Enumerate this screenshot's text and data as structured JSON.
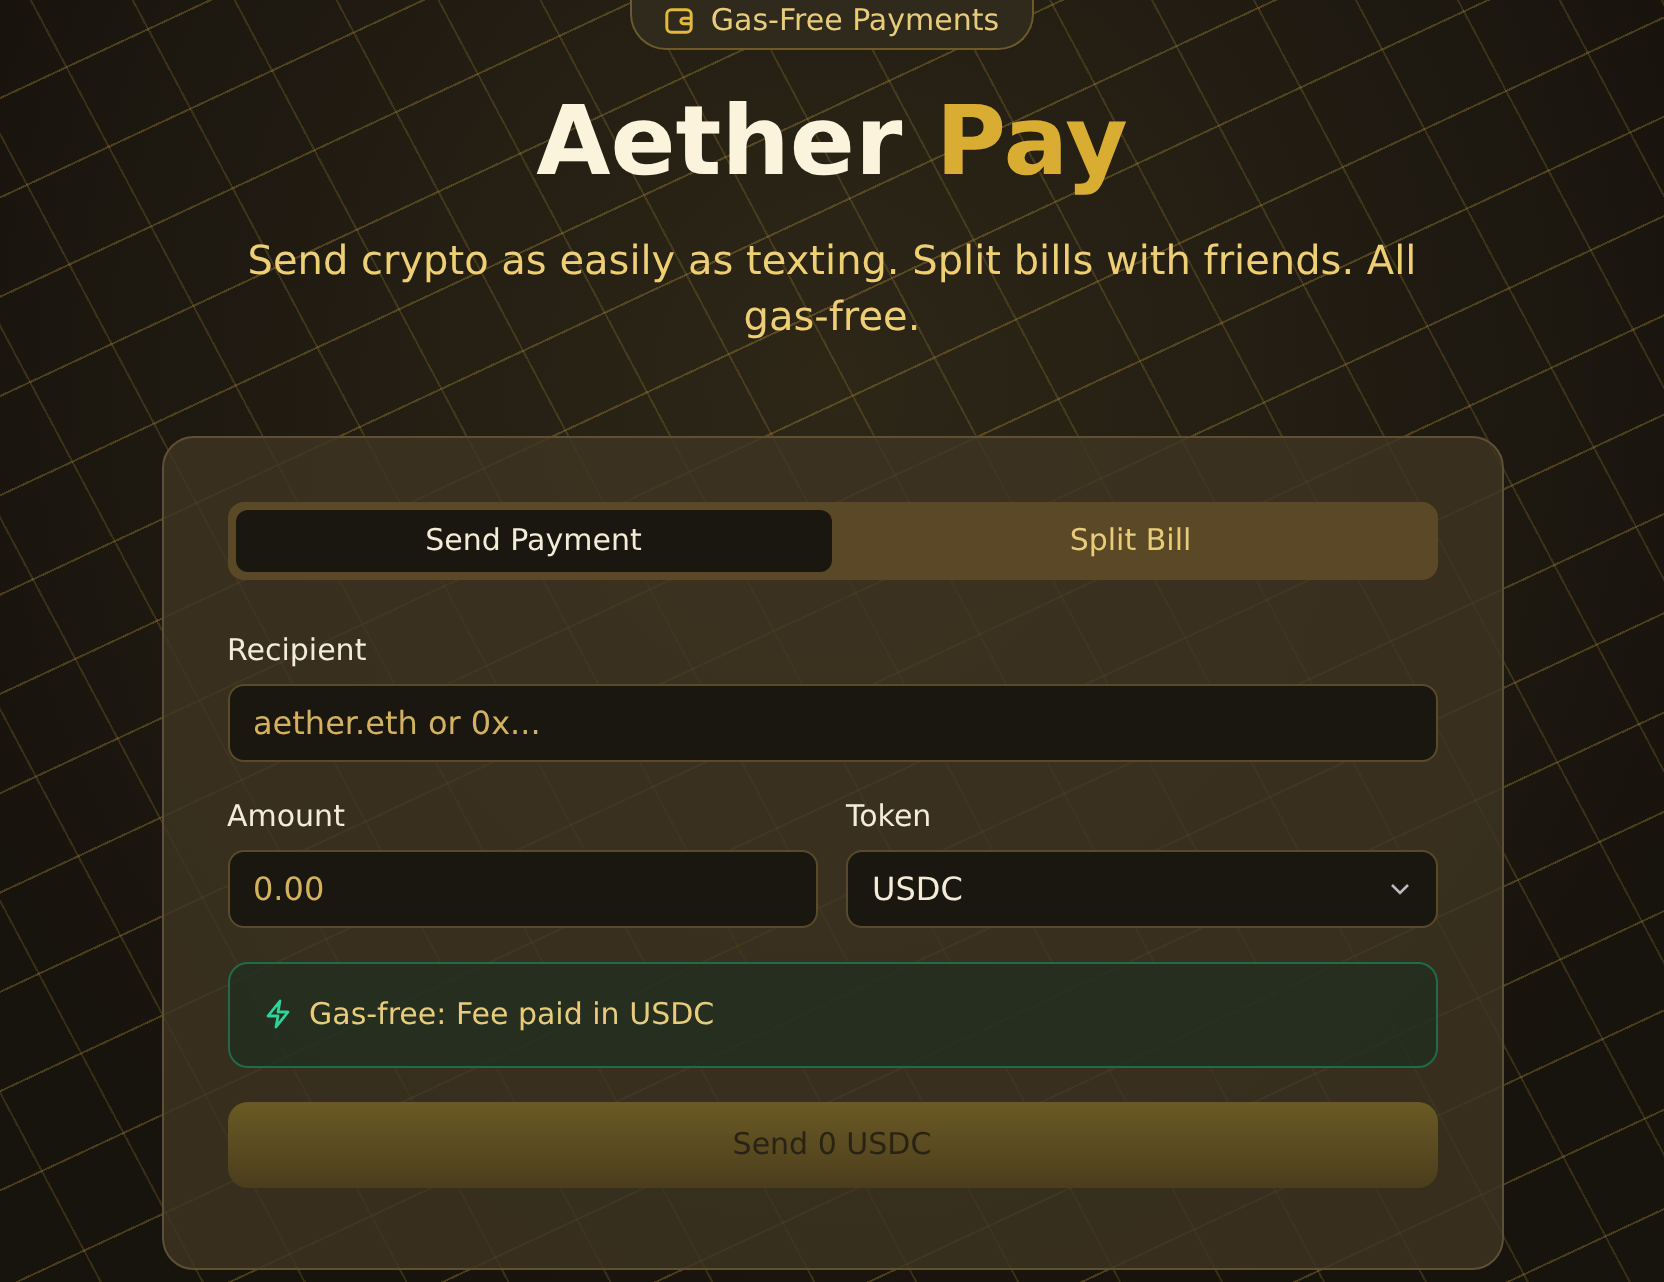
{
  "badge": {
    "label": "Gas-Free Payments"
  },
  "title": {
    "main": "Aether",
    "accent": "Pay"
  },
  "subtitle": "Send crypto as easily as texting. Split bills with friends. All gas-free.",
  "tabs": [
    {
      "label": "Send Payment",
      "selected": true
    },
    {
      "label": "Split Bill",
      "selected": false
    }
  ],
  "recipient": {
    "label": "Recipient",
    "placeholder": "aether.eth or 0x..."
  },
  "amount": {
    "label": "Amount",
    "placeholder": "0.00"
  },
  "token": {
    "label": "Token",
    "value": "USDC"
  },
  "notice": "Gas-free: Fee paid in USDC",
  "send_button": {
    "label": "Send 0 USDC",
    "disabled": true
  }
}
